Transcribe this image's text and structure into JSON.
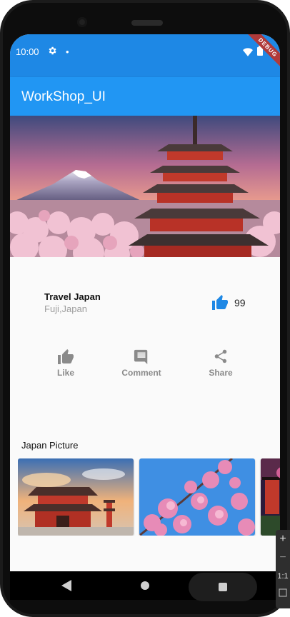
{
  "status_bar": {
    "time": "10:00",
    "dot": "•",
    "debug_banner": "DEBUG",
    "icons": [
      "gear-icon",
      "wifi-icon",
      "battery-icon"
    ]
  },
  "app_bar": {
    "title": "WorkShop_UI",
    "color": "#2196f3"
  },
  "post": {
    "title": "Travel Japan",
    "subtitle": "Fuji,Japan",
    "like_count": "99"
  },
  "actions": [
    {
      "label": "Like",
      "icon": "thumb-up-icon"
    },
    {
      "label": "Comment",
      "icon": "comment-icon"
    },
    {
      "label": "Share",
      "icon": "share-icon"
    }
  ],
  "gallery": {
    "label": "Japan Picture"
  },
  "zoom_controls": {
    "plus": "+",
    "minus": "−",
    "ratio": "1:1"
  },
  "colors": {
    "accent": "#1e88e5",
    "action_grey": "#8a8a8a"
  }
}
